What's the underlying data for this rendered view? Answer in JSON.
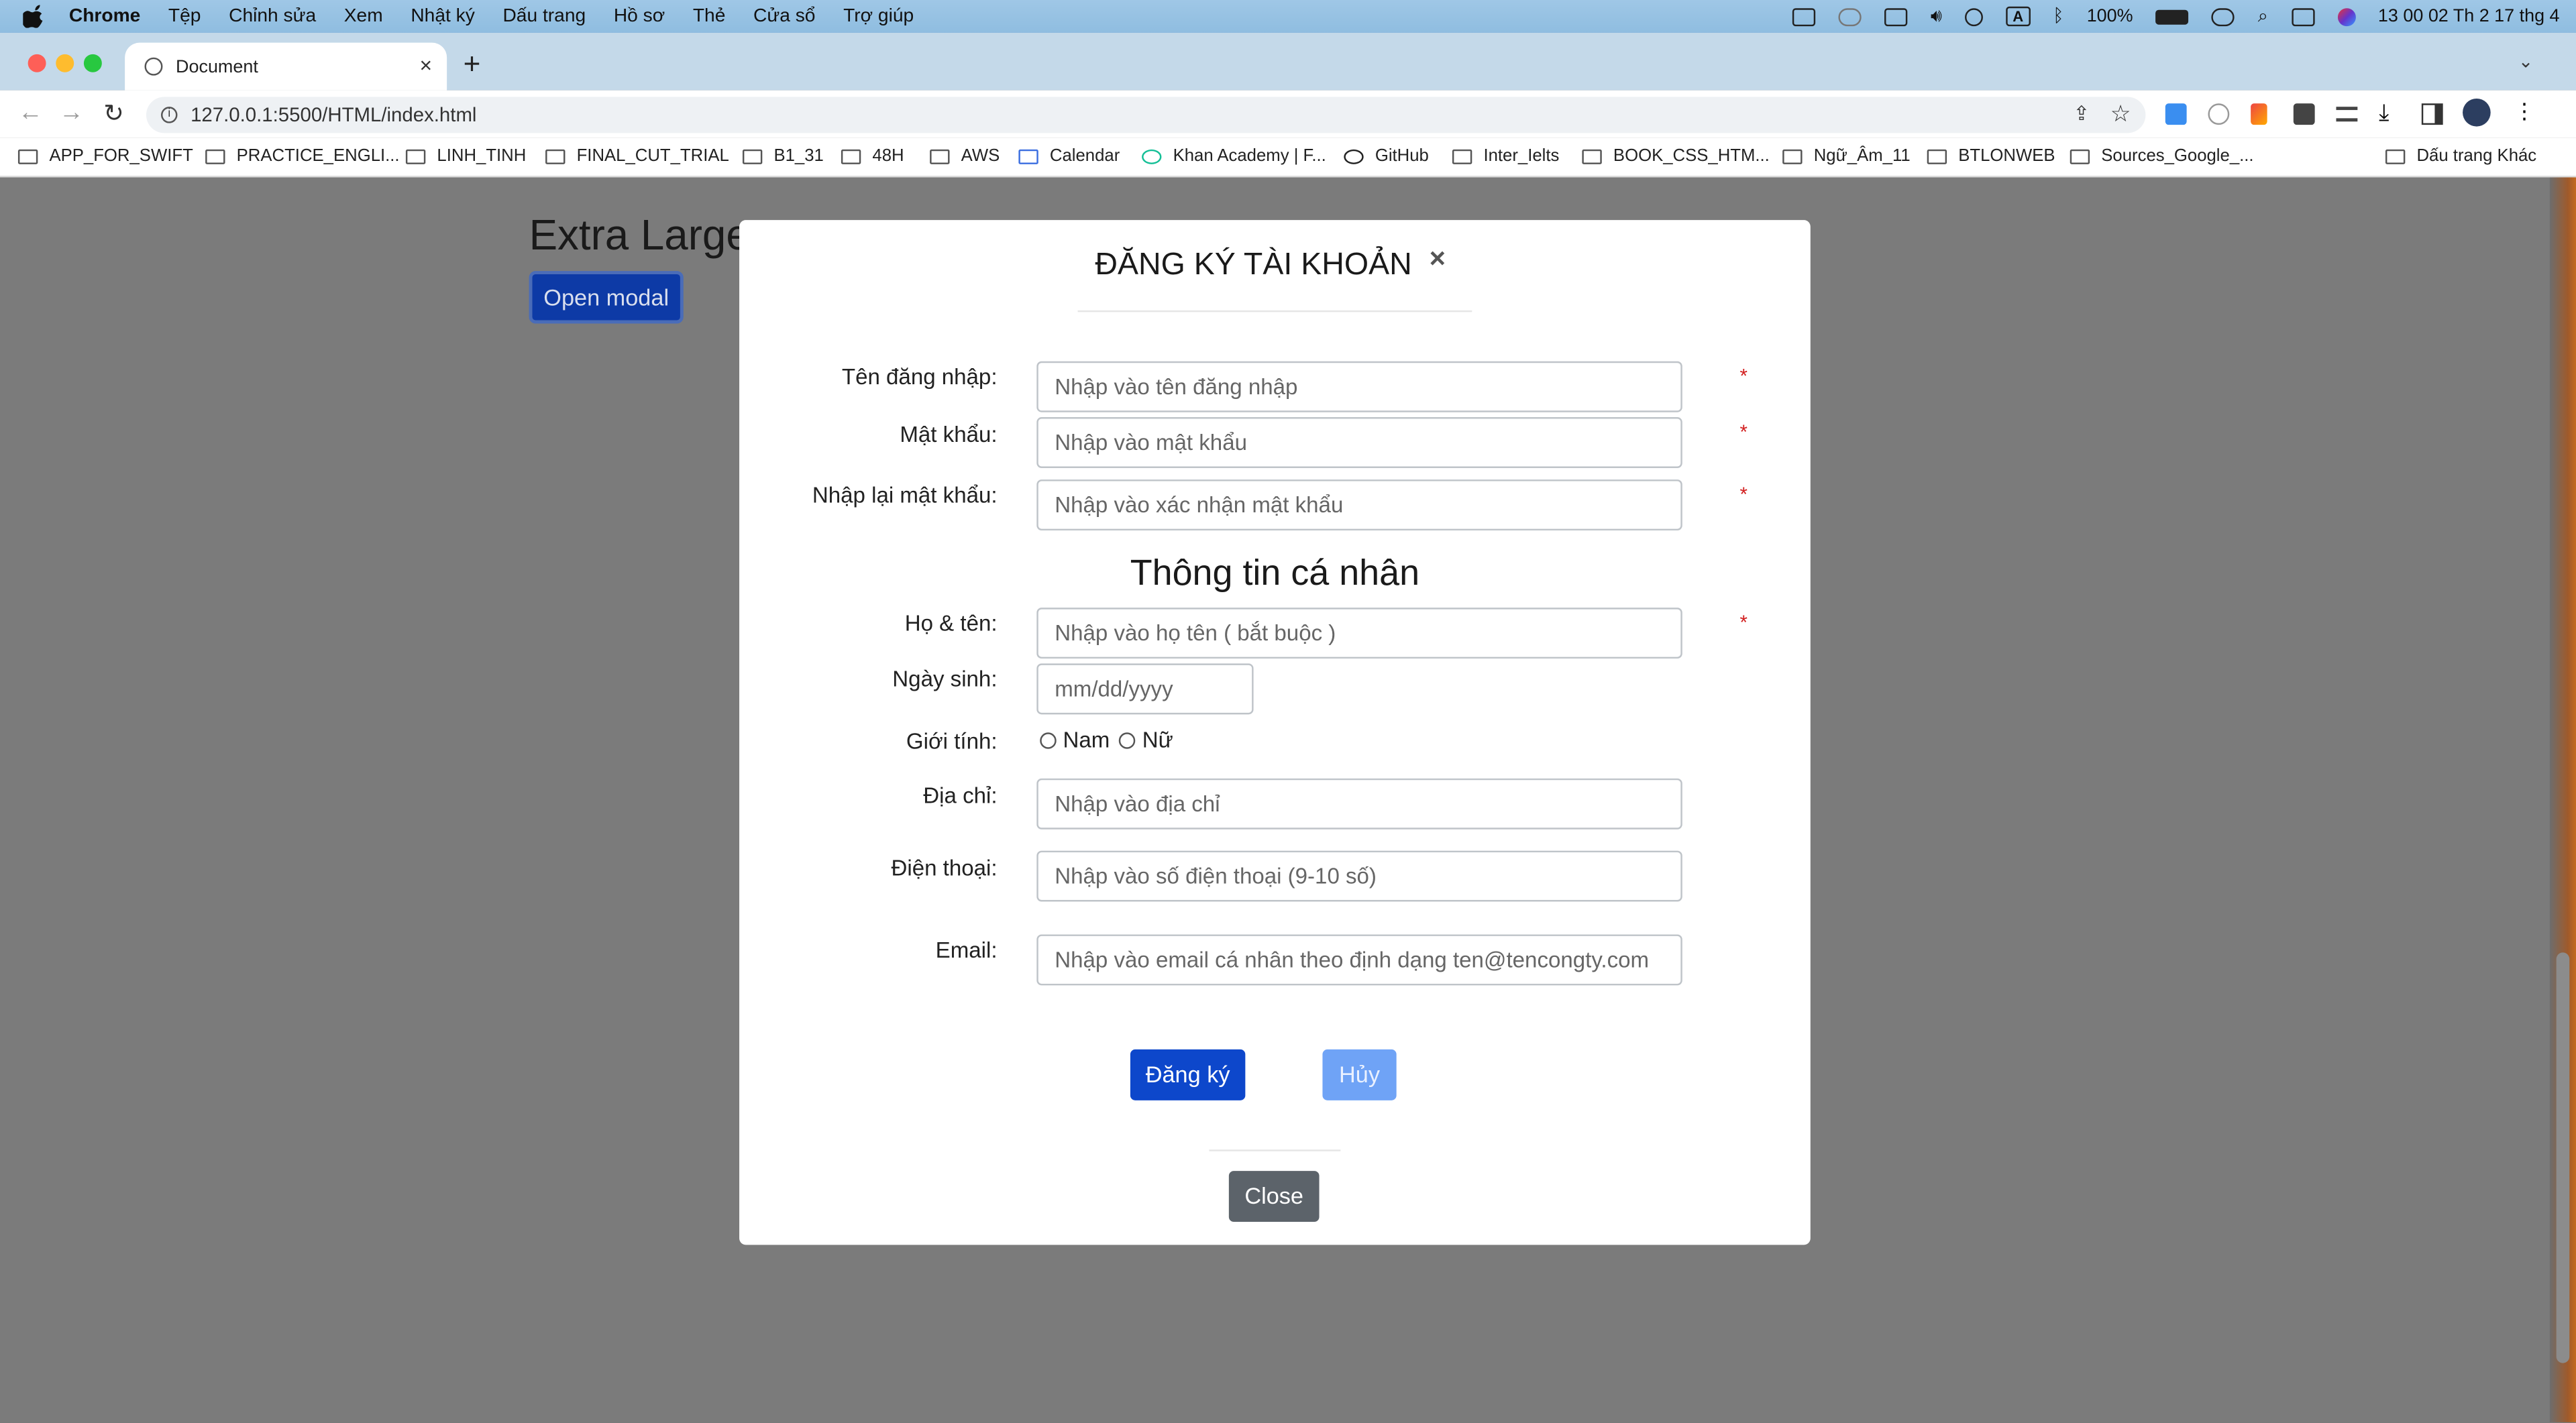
{
  "menubar": {
    "app": "Chrome",
    "items": [
      "Tệp",
      "Chỉnh sửa",
      "Xem",
      "Nhật ký",
      "Dấu trang",
      "Hồ sơ",
      "Thẻ",
      "Cửa sổ",
      "Trợ giúp"
    ],
    "battery": "100%",
    "input_source": "A",
    "datetime": "13 00 02 Th 2 17 thg 4"
  },
  "tab": {
    "title": "Document",
    "close": "×",
    "new": "+"
  },
  "toolbar": {
    "url": "127.0.0.1:5500/HTML/index.html"
  },
  "bookmarks": {
    "items": [
      "APP_FOR_SWIFT",
      "PRACTICE_ENGLI...",
      "LINH_TINH",
      "FINAL_CUT_TRIAL",
      "B1_31",
      "48H",
      "AWS",
      "Calendar",
      "Khan Academy | F...",
      "GitHub",
      "Inter_Ielts",
      "BOOK_CSS_HTM...",
      "Ngữ_Âm_11",
      "BTLONWEB",
      "Sources_Google_..."
    ],
    "other": "Dấu trang Khác"
  },
  "page": {
    "title": "Extra Large",
    "open_button": "Open modal"
  },
  "modal": {
    "title": "ĐĂNG KÝ TÀI KHOẢN",
    "close_x": "×",
    "username_label": "Tên đăng nhập:",
    "username_placeholder": "Nhập vào tên đăng nhập",
    "password_label": "Mật khẩu:",
    "password_placeholder": "Nhập vào mật khẩu",
    "confirm_label": "Nhập lại mật khẩu:",
    "confirm_placeholder": "Nhập vào xác nhận mật khẩu",
    "section_title": "Thông tin cá nhân",
    "fullname_label": "Họ & tên:",
    "fullname_placeholder": "Nhập vào họ tên ( bắt buộc )",
    "dob_label": "Ngày sinh:",
    "dob_placeholder": "mm/dd/yyyy",
    "gender_label": "Giới tính:",
    "gender_male": "Nam",
    "gender_female": "Nữ",
    "address_label": "Địa chỉ:",
    "address_placeholder": "Nhập vào địa chỉ",
    "phone_label": "Điện thoại:",
    "phone_placeholder": "Nhập vào số điện thoại (9-10 số)",
    "email_label": "Email:",
    "email_placeholder": "Nhập vào email cá nhân theo định dạng ten@tencongty.com",
    "required_mark": "*",
    "register_button": "Đăng ký",
    "cancel_button": "Hủy",
    "close_button": "Close"
  }
}
